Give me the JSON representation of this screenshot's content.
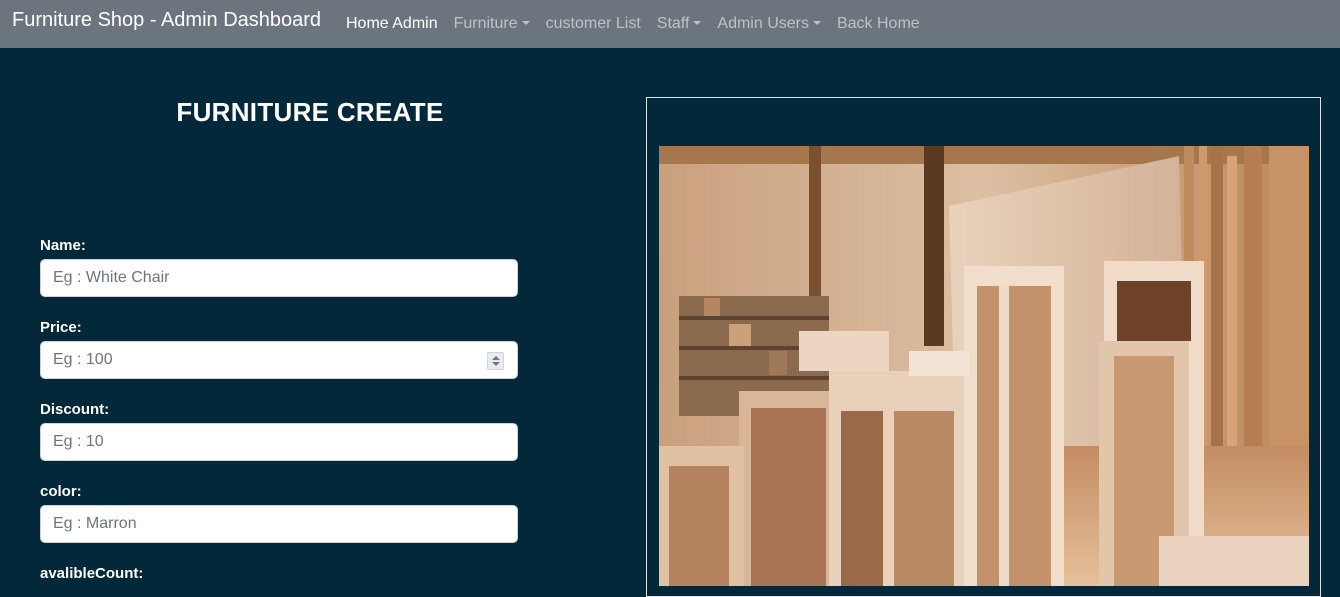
{
  "navbar": {
    "brand": "Furniture Shop - Admin Dashboard",
    "items": [
      {
        "label": "Home Admin",
        "active": true,
        "dropdown": false
      },
      {
        "label": "Furniture",
        "active": false,
        "dropdown": true
      },
      {
        "label": "customer List",
        "active": false,
        "dropdown": false
      },
      {
        "label": "Staff",
        "active": false,
        "dropdown": true
      },
      {
        "label": "Admin Users",
        "active": false,
        "dropdown": true
      },
      {
        "label": "Back Home",
        "active": false,
        "dropdown": false
      }
    ]
  },
  "form": {
    "title": "FURNITURE CREATE",
    "fields": [
      {
        "label": "Name:",
        "placeholder": "Eg : White Chair",
        "value": ""
      },
      {
        "label": "Price:",
        "placeholder": "Eg : 100",
        "value": ""
      },
      {
        "label": "Discount:",
        "placeholder": "Eg : 10",
        "value": ""
      },
      {
        "label": "color:",
        "placeholder": "Eg : Marron",
        "value": ""
      },
      {
        "label": "avalibleCount:"
      }
    ]
  },
  "image_panel": {
    "image_subject": "furniture-showroom-photo"
  },
  "colors": {
    "page_background": "#022839",
    "navbar_background": "#6c757d",
    "text": "#ffffff"
  }
}
